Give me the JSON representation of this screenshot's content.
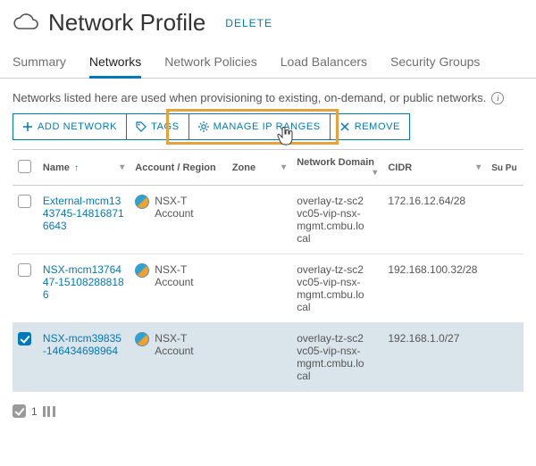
{
  "header": {
    "title": "Network Profile",
    "delete_label": "DELETE"
  },
  "tabs": [
    {
      "label": "Summary",
      "active": false
    },
    {
      "label": "Networks",
      "active": true
    },
    {
      "label": "Network Policies",
      "active": false
    },
    {
      "label": "Load Balancers",
      "active": false
    },
    {
      "label": "Security Groups",
      "active": false
    }
  ],
  "description": "Networks listed here are used when provisioning to existing, on-demand, or public networks.",
  "toolbar": {
    "add": "ADD NETWORK",
    "tags": "TAGS",
    "manage": "MANAGE IP RANGES",
    "remove": "REMOVE"
  },
  "columns": {
    "name": "Name",
    "account": "Account / Region",
    "zone": "Zone",
    "domain": "Network Domain",
    "cidr": "CIDR",
    "support": "Su Pu"
  },
  "rows": [
    {
      "selected": false,
      "name": "External-mcm1343745-148168716643",
      "account": "NSX-T Account",
      "zone": "",
      "domain": "overlay-tz-sc2vc05-vip-nsx-mgmt.cmbu.local",
      "cidr": "172.16.12.64/28"
    },
    {
      "selected": false,
      "name": "NSX-mcm1376447-151082888186",
      "account": "NSX-T Account",
      "zone": "",
      "domain": "overlay-tz-sc2vc05-vip-nsx-mgmt.cmbu.local",
      "cidr": "192.168.100.32/28"
    },
    {
      "selected": true,
      "name": "NSX-mcm39835-146434698964",
      "account": "NSX-T Account",
      "zone": "",
      "domain": "overlay-tz-sc2vc05-vip-nsx-mgmt.cmbu.local",
      "cidr": "192.168.1.0/27"
    }
  ],
  "footer": {
    "count": "1"
  }
}
